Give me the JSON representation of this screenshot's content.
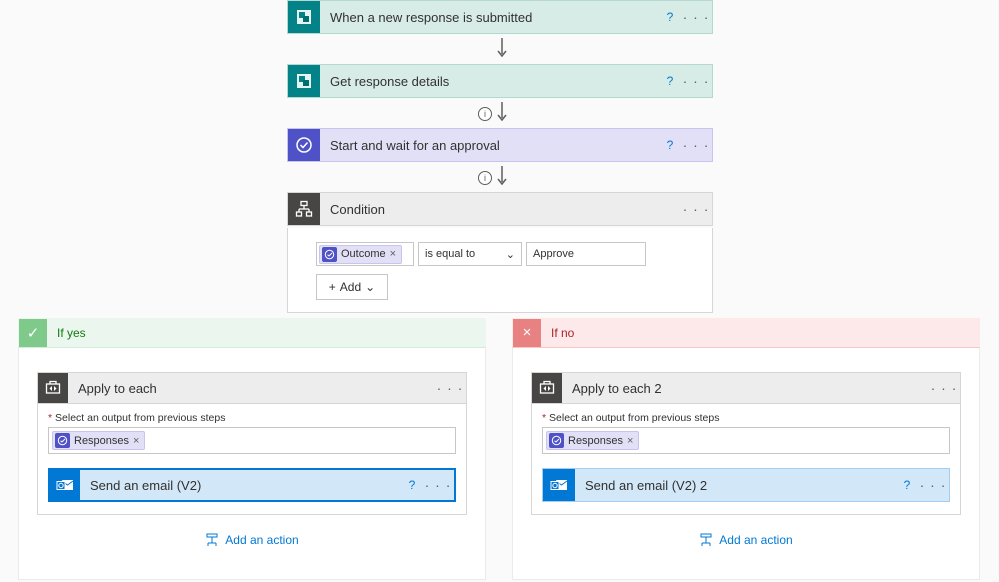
{
  "steps": {
    "trigger_title": "When a new response is submitted",
    "get_details_title": "Get response details",
    "approval_title": "Start and wait for an approval",
    "condition_title": "Condition"
  },
  "condition": {
    "token_label": "Outcome",
    "operator": "is equal to",
    "value": "Approve",
    "add_label": "Add"
  },
  "branches": {
    "yes_label": "If yes",
    "no_label": "If no"
  },
  "yes": {
    "ate_title": "Apply to each",
    "field_label": "Select an output from previous steps",
    "token_label": "Responses",
    "email_title": "Send an email (V2)",
    "add_action": "Add an action"
  },
  "no": {
    "ate_title": "Apply to each 2",
    "field_label": "Select an output from previous steps",
    "token_label": "Responses",
    "email_title": "Send an email (V2) 2",
    "add_action": "Add an action"
  },
  "glyph": {
    "more": "· · ·",
    "help": "?",
    "chev": "⌄",
    "plus": "+",
    "x": "×",
    "check": "✓"
  }
}
